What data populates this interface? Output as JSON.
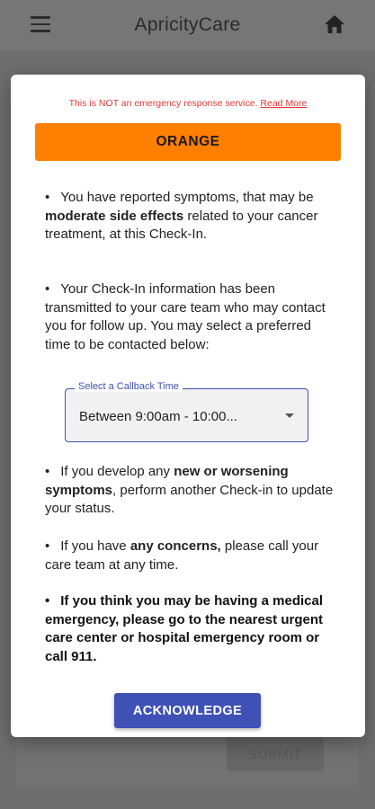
{
  "app_bar": {
    "title": "ApricityCare",
    "menu_icon": "menu-icon",
    "home_icon": "home-icon"
  },
  "background": {
    "submit_label": "SUBMIT"
  },
  "modal": {
    "disclaimer_text": "This is NOT an emergency response service.",
    "read_more_label": "Read More",
    "level_label": "ORANGE",
    "level_color": "#ff7f00",
    "bullet": "•",
    "paragraph1": {
      "pre": "You have reported symptoms, that may be ",
      "bold": "moderate side effects",
      "post": " related to your cancer treatment, at this Check-In."
    },
    "paragraph2": "Your Check-In information has been transmitted to your care team who may contact you for follow up. You may select a preferred time to be contacted below:",
    "callback": {
      "label": "Select a Callback Time",
      "value": "Between 9:00am - 10:00..."
    },
    "paragraph3": {
      "pre": "If you develop any ",
      "bold": "new or worsening symptoms",
      "post": ", perform another Check-in to update your status."
    },
    "paragraph4": {
      "pre": "If you have ",
      "bold": "any concerns,",
      "post": " please call your care team at any time."
    },
    "paragraph5": "If you think you may be having a medical emergency, please go to the nearest urgent care center or hospital emergency room or call 911.",
    "acknowledge_label": "ACKNOWLEDGE"
  },
  "colors": {
    "accent": "#3f51b5",
    "warning_text": "#e53935",
    "overlay": "#6e6e6e"
  }
}
